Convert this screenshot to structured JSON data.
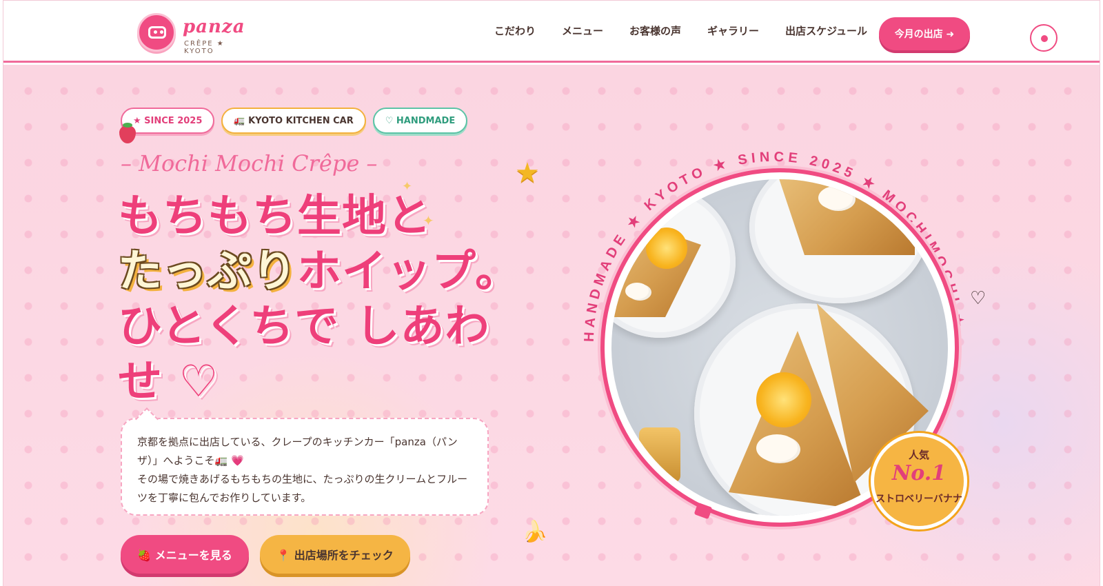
{
  "logo": {
    "word": "panza",
    "sub": "CRÊPE ★ KYOTO"
  },
  "nav": [
    "こだわり",
    "メニュー",
    "お客様の声",
    "ギャラリー",
    "出店スケジュール"
  ],
  "header_cta": "今月の出店 ➜",
  "badges": [
    "★ SINCE 2025",
    "🚛 KYOTO KITCHEN CAR",
    "♡ HANDMADE"
  ],
  "tagline": "– Mochi Mochi Crêpe –",
  "headline": {
    "line1": "もちもち生地と",
    "accent": "たっぷり",
    "line2_rest": "ホイップ。",
    "line3": "ひとくちで しあわ",
    "line4": "せ ♡"
  },
  "intro": {
    "p1": "京都を拠点に出店している、クレープのキッチンカー「panza（パンザ）」へようこそ🚛 💗",
    "p2": "その場で焼きあげるもちもちの生地に、たっぷりの生クリームとフルーツを丁寧に包んでお作りしています。"
  },
  "buttons": {
    "menu": "🍓 メニューを見る",
    "map": "📍 出店場所をチェック"
  },
  "ring_text": "HANDMADE ★ KYOTO ★ SINCE 2025 ★ MOCHIMOCHI ★",
  "popular_badge": {
    "label": "人気",
    "rank": "No.1",
    "item": "ストロベリーバナナ"
  },
  "icons": {
    "star": "star-icon",
    "heart": "heart-icon",
    "banana": "banana-icon",
    "strawberry": "strawberry-icon"
  },
  "colors": {
    "brand_pink": "#f04b82",
    "accent_yellow": "#f5b544",
    "text": "#4a3530"
  }
}
